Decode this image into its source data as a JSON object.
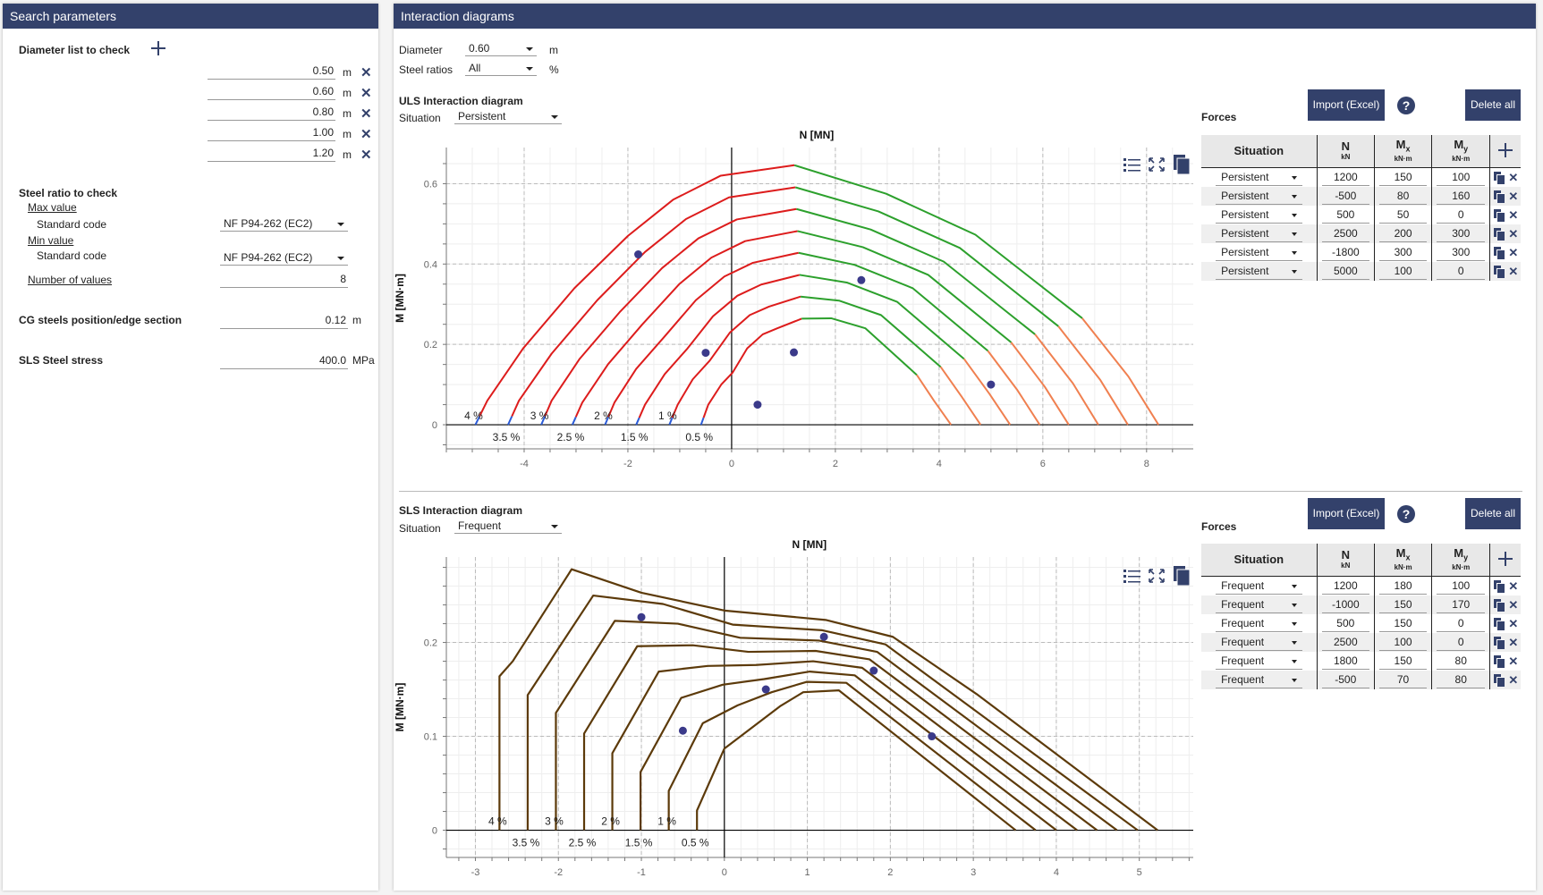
{
  "left": {
    "title": "Search parameters",
    "diameter_list_label": "Diameter list to check",
    "diameters": [
      {
        "value": "0.50",
        "unit": "m"
      },
      {
        "value": "0.60",
        "unit": "m"
      },
      {
        "value": "0.80",
        "unit": "m"
      },
      {
        "value": "1.00",
        "unit": "m"
      },
      {
        "value": "1.20",
        "unit": "m"
      }
    ],
    "steel_ratio_label": "Steel ratio to check",
    "max_value_label": "Max value",
    "max_std_label": "Standard code",
    "max_std_value": "NF P94-262 (EC2)",
    "min_value_label": "Min value",
    "min_std_label": "Standard code",
    "min_std_value": "NF P94-262 (EC2)",
    "num_values_label": "Number of values",
    "num_values": "8",
    "cg_label": "CG steels position/edge section",
    "cg_value": "0.12",
    "cg_unit": "m",
    "sls_stress_label": "SLS Steel stress",
    "sls_stress_value": "400.0",
    "sls_stress_unit": "MPa"
  },
  "right": {
    "title": "Interaction diagrams",
    "diameter_label": "Diameter",
    "diameter_value": "0.60",
    "diameter_unit": "m",
    "steel_ratios_label": "Steel ratios",
    "steel_ratios_value": "All",
    "steel_ratios_unit": "%"
  },
  "uls": {
    "title": "ULS Interaction diagram",
    "situation_label": "Situation",
    "situation_value": "Persistent",
    "forces_label": "Forces",
    "import_label": "Import (Excel)",
    "help_label": "?",
    "delete_all_label": "Delete all",
    "columns": [
      {
        "main": "Situation",
        "sub": ""
      },
      {
        "main": "N",
        "sub": "kN"
      },
      {
        "main": "M",
        "subscript": "x",
        "sub": "kN·m"
      },
      {
        "main": "M",
        "subscript": "y",
        "sub": "kN·m"
      }
    ],
    "rows": [
      {
        "situation": "Persistent",
        "N": "1200",
        "Mx": "150",
        "My": "100"
      },
      {
        "situation": "Persistent",
        "N": "-500",
        "Mx": "80",
        "My": "160"
      },
      {
        "situation": "Persistent",
        "N": "500",
        "Mx": "50",
        "My": "0"
      },
      {
        "situation": "Persistent",
        "N": "2500",
        "Mx": "200",
        "My": "300"
      },
      {
        "situation": "Persistent",
        "N": "-1800",
        "Mx": "300",
        "My": "300"
      },
      {
        "situation": "Persistent",
        "N": "5000",
        "Mx": "100",
        "My": "0"
      }
    ]
  },
  "sls": {
    "title": "SLS Interaction diagram",
    "situation_label": "Situation",
    "situation_value": "Frequent",
    "forces_label": "Forces",
    "import_label": "Import (Excel)",
    "help_label": "?",
    "delete_all_label": "Delete all",
    "columns": [
      {
        "main": "Situation",
        "sub": ""
      },
      {
        "main": "N",
        "sub": "kN"
      },
      {
        "main": "M",
        "subscript": "x",
        "sub": "kN·m"
      },
      {
        "main": "M",
        "subscript": "y",
        "sub": "kN·m"
      }
    ],
    "rows": [
      {
        "situation": "Frequent",
        "N": "1200",
        "Mx": "180",
        "My": "100"
      },
      {
        "situation": "Frequent",
        "N": "-1000",
        "Mx": "150",
        "My": "170"
      },
      {
        "situation": "Frequent",
        "N": "500",
        "Mx": "150",
        "My": "0"
      },
      {
        "situation": "Frequent",
        "N": "2500",
        "Mx": "100",
        "My": "0"
      },
      {
        "situation": "Frequent",
        "N": "1800",
        "Mx": "150",
        "My": "80"
      },
      {
        "situation": "Frequent",
        "N": "-500",
        "Mx": "70",
        "My": "80"
      }
    ]
  },
  "icons": {
    "legend": "list-icon",
    "fullscreen": "expand-icon",
    "copy": "copy-icon",
    "add": "plus-icon",
    "delete": "close-icon"
  },
  "colors": {
    "accent": "#33416b",
    "uls_tension_base": "#2a5bd7",
    "uls_red": "#dd1c1c",
    "uls_green": "#2ca02c",
    "uls_orange": "#f08050",
    "sls_curve": "#5c3a0a",
    "point": "#3b3a8a"
  },
  "chart_data": [
    {
      "type": "line",
      "title": "ULS Interaction diagram",
      "xlabel": "N [MN]",
      "ylabel": "M [MN·m]",
      "xlim": [
        -5.5,
        8.9
      ],
      "ylim": [
        -0.06,
        0.69
      ],
      "xticks": [
        -4,
        -2,
        0,
        2,
        4,
        6,
        8
      ],
      "yticks": [
        0,
        0.2,
        0.4,
        0.6
      ],
      "grid": true,
      "series": [
        {
          "name": "0.5 %",
          "label_pos": "below",
          "points": [
            [
              -0.59,
              0
            ],
            [
              -0.45,
              0.05
            ],
            [
              -0.2,
              0.1
            ],
            [
              0.02,
              0.13
            ],
            [
              0.3,
              0.19
            ],
            [
              0.6,
              0.225
            ],
            [
              0.88,
              0.24
            ],
            [
              1.35,
              0.264
            ],
            [
              1.92,
              0.265
            ],
            [
              2.58,
              0.24
            ],
            [
              3.57,
              0.124
            ],
            [
              3.9,
              0.06
            ],
            [
              4.23,
              0
            ]
          ]
        },
        {
          "name": "1 %",
          "label_pos": "above",
          "points": [
            [
              -1.2,
              0
            ],
            [
              -1.04,
              0.05
            ],
            [
              -0.75,
              0.113
            ],
            [
              -0.42,
              0.16
            ],
            [
              -0.03,
              0.23
            ],
            [
              0.35,
              0.273
            ],
            [
              0.72,
              0.294
            ],
            [
              1.33,
              0.319
            ],
            [
              2.07,
              0.309
            ],
            [
              2.88,
              0.273
            ],
            [
              4.03,
              0.144
            ],
            [
              4.44,
              0.069
            ],
            [
              4.8,
              0
            ]
          ]
        },
        {
          "name": "1.5 %",
          "label_pos": "below",
          "points": [
            [
              -1.84,
              0
            ],
            [
              -1.67,
              0.05
            ],
            [
              -1.29,
              0.126
            ],
            [
              -0.85,
              0.19
            ],
            [
              -0.36,
              0.27
            ],
            [
              0.11,
              0.321
            ],
            [
              0.57,
              0.349
            ],
            [
              1.31,
              0.373
            ],
            [
              2.22,
              0.354
            ],
            [
              3.19,
              0.306
            ],
            [
              4.48,
              0.164
            ],
            [
              4.97,
              0.077
            ],
            [
              5.37,
              0
            ]
          ]
        },
        {
          "name": "2 %",
          "label_pos": "above",
          "points": [
            [
              -2.44,
              0
            ],
            [
              -2.26,
              0.055
            ],
            [
              -1.84,
              0.139
            ],
            [
              -1.29,
              0.22
            ],
            [
              -0.69,
              0.31
            ],
            [
              -0.14,
              0.369
            ],
            [
              0.41,
              0.403
            ],
            [
              1.29,
              0.428
            ],
            [
              2.37,
              0.398
            ],
            [
              3.49,
              0.34
            ],
            [
              4.94,
              0.184
            ],
            [
              5.51,
              0.086
            ],
            [
              5.94,
              0
            ]
          ]
        },
        {
          "name": "2.5 %",
          "label_pos": "below",
          "points": [
            [
              -3.07,
              0
            ],
            [
              -2.88,
              0.055
            ],
            [
              -2.38,
              0.151
            ],
            [
              -1.72,
              0.25
            ],
            [
              -1.01,
              0.35
            ],
            [
              -0.39,
              0.416
            ],
            [
              0.26,
              0.457
            ],
            [
              1.27,
              0.482
            ],
            [
              2.53,
              0.442
            ],
            [
              3.79,
              0.373
            ],
            [
              5.39,
              0.205
            ],
            [
              6.04,
              0.094
            ],
            [
              6.5,
              0
            ]
          ]
        },
        {
          "name": "3 %",
          "label_pos": "above",
          "points": [
            [
              -3.67,
              0
            ],
            [
              -3.47,
              0.06
            ],
            [
              -2.93,
              0.164
            ],
            [
              -2.16,
              0.28
            ],
            [
              -1.34,
              0.39
            ],
            [
              -0.64,
              0.464
            ],
            [
              0.1,
              0.511
            ],
            [
              1.25,
              0.537
            ],
            [
              2.68,
              0.486
            ],
            [
              4.09,
              0.406
            ],
            [
              5.85,
              0.225
            ],
            [
              6.58,
              0.103
            ],
            [
              7.07,
              0
            ]
          ]
        },
        {
          "name": "3.5 %",
          "label_pos": "below",
          "points": [
            [
              -4.31,
              0
            ],
            [
              -4.1,
              0.06
            ],
            [
              -3.47,
              0.177
            ],
            [
              -2.59,
              0.31
            ],
            [
              -1.67,
              0.43
            ],
            [
              -0.88,
              0.512
            ],
            [
              -0.05,
              0.566
            ],
            [
              1.23,
              0.591
            ],
            [
              2.83,
              0.531
            ],
            [
              4.4,
              0.44
            ],
            [
              6.3,
              0.245
            ],
            [
              7.11,
              0.111
            ],
            [
              7.64,
              0
            ]
          ]
        },
        {
          "name": "4 %",
          "label_pos": "above",
          "points": [
            [
              -4.94,
              0
            ],
            [
              -4.71,
              0.06
            ],
            [
              -4.02,
              0.19
            ],
            [
              -3.03,
              0.34
            ],
            [
              -2.0,
              0.47
            ],
            [
              -1.13,
              0.56
            ],
            [
              -0.21,
              0.62
            ],
            [
              1.21,
              0.646
            ],
            [
              2.98,
              0.575
            ],
            [
              4.7,
              0.473
            ],
            [
              6.76,
              0.265
            ],
            [
              7.65,
              0.12
            ],
            [
              8.23,
              0
            ]
          ]
        }
      ],
      "segments": {
        "red_end_index": 7,
        "green_end_index": 10
      },
      "points": [
        [
          1.2,
          0.18
        ],
        [
          -0.5,
          0.179
        ],
        [
          0.5,
          0.05
        ],
        [
          2.5,
          0.36
        ],
        [
          -1.8,
          0.424
        ],
        [
          5.0,
          0.1
        ]
      ]
    },
    {
      "type": "line",
      "title": "SLS Interaction diagram",
      "xlabel": "N [MN]",
      "ylabel": "M [MN·m]",
      "xlim": [
        -3.35,
        5.65
      ],
      "ylim": [
        -0.029,
        0.291
      ],
      "xticks": [
        -3,
        -2,
        -1,
        0,
        1,
        2,
        3,
        4,
        5
      ],
      "yticks": [
        0,
        0.1,
        0.2
      ],
      "grid": true,
      "series": [
        {
          "name": "0.5 %",
          "label_pos": "below",
          "points": [
            [
              -0.33,
              0
            ],
            [
              -0.33,
              0.021
            ],
            [
              0,
              0.087
            ],
            [
              0.67,
              0.132
            ],
            [
              0.95,
              0.147
            ],
            [
              1.38,
              0.149
            ],
            [
              3.51,
              0
            ]
          ]
        },
        {
          "name": "1 %",
          "label_pos": "above",
          "points": [
            [
              -0.67,
              0
            ],
            [
              -0.67,
              0.042
            ],
            [
              -0.26,
              0.114
            ],
            [
              0.16,
              0.133
            ],
            [
              0.57,
              0.147
            ],
            [
              0.99,
              0.158
            ],
            [
              1.47,
              0.157
            ],
            [
              3.75,
              0
            ]
          ]
        },
        {
          "name": "1.5 %",
          "label_pos": "below",
          "points": [
            [
              -1.01,
              0
            ],
            [
              -1.01,
              0.062
            ],
            [
              -0.52,
              0.141
            ],
            [
              -0.02,
              0.155
            ],
            [
              0.48,
              0.161
            ],
            [
              1.03,
              0.169
            ],
            [
              1.57,
              0.165
            ],
            [
              4.0,
              0
            ]
          ]
        },
        {
          "name": "2 %",
          "label_pos": "above",
          "points": [
            [
              -1.35,
              0
            ],
            [
              -1.35,
              0.082
            ],
            [
              -0.79,
              0.169
            ],
            [
              -0.2,
              0.175
            ],
            [
              0.38,
              0.176
            ],
            [
              1.07,
              0.18
            ],
            [
              1.66,
              0.173
            ],
            [
              4.25,
              0
            ]
          ]
        },
        {
          "name": "2.5 %",
          "label_pos": "below",
          "points": [
            [
              -1.69,
              0
            ],
            [
              -1.69,
              0.103
            ],
            [
              -1.05,
              0.196
            ],
            [
              -0.38,
              0.197
            ],
            [
              0.29,
              0.19
            ],
            [
              1.1,
              0.191
            ],
            [
              1.75,
              0.182
            ],
            [
              4.49,
              0
            ]
          ]
        },
        {
          "name": "3 %",
          "label_pos": "above",
          "points": [
            [
              -2.03,
              0
            ],
            [
              -2.03,
              0.125
            ],
            [
              -1.32,
              0.223
            ],
            [
              -0.56,
              0.22
            ],
            [
              0.19,
              0.205
            ],
            [
              1.14,
              0.202
            ],
            [
              1.84,
              0.19
            ],
            [
              4.73,
              0
            ]
          ]
        },
        {
          "name": "3.5 %",
          "label_pos": "below",
          "points": [
            [
              -2.37,
              0
            ],
            [
              -2.37,
              0.144
            ],
            [
              -1.58,
              0.25
            ],
            [
              -0.74,
              0.241
            ],
            [
              0.1,
              0.219
            ],
            [
              1.18,
              0.213
            ],
            [
              1.94,
              0.198
            ],
            [
              4.98,
              0
            ]
          ]
        },
        {
          "name": "4 %",
          "label_pos": "above",
          "points": [
            [
              -2.71,
              0
            ],
            [
              -2.71,
              0.164
            ],
            [
              -2.55,
              0.18
            ],
            [
              -1.84,
              0.278
            ],
            [
              -1.0,
              0.253
            ],
            [
              0,
              0.234
            ],
            [
              1.22,
              0.224
            ],
            [
              2.03,
              0.206
            ],
            [
              3.04,
              0.145
            ],
            [
              5.22,
              0
            ]
          ]
        }
      ],
      "points": [
        [
          1.2,
          0.206
        ],
        [
          -1.0,
          0.227
        ],
        [
          0.5,
          0.15
        ],
        [
          2.5,
          0.1
        ],
        [
          1.8,
          0.17
        ],
        [
          -0.5,
          0.106
        ]
      ]
    }
  ]
}
